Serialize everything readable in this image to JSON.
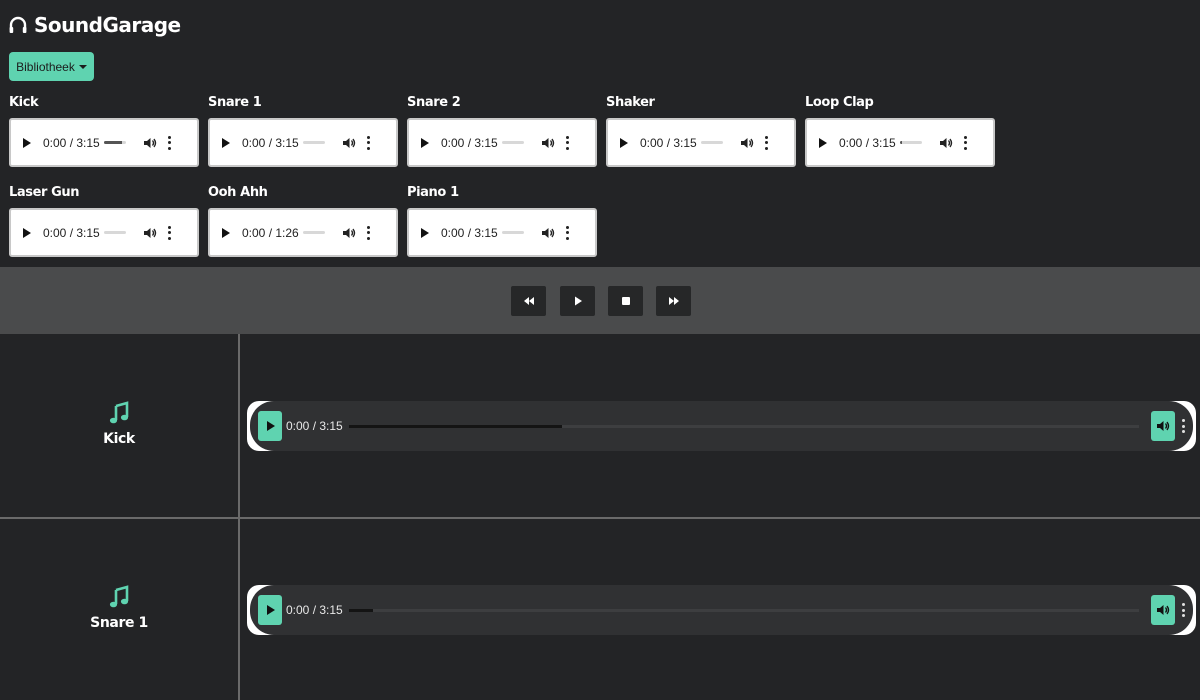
{
  "app": {
    "title": "SoundGarage",
    "library_button": "Bibliotheek",
    "accent_color": "#5fd3b0"
  },
  "library": {
    "clips": [
      {
        "name": "Kick",
        "time": "0:00 / 3:15",
        "progress": 0.8
      },
      {
        "name": "Snare 1",
        "time": "0:00 / 3:15",
        "progress": 0
      },
      {
        "name": "Snare 2",
        "time": "0:00 / 3:15",
        "progress": 0
      },
      {
        "name": "Shaker",
        "time": "0:00 / 3:15",
        "progress": 0
      },
      {
        "name": "Loop Clap",
        "time": "0:00 / 3:15",
        "progress": 0.1
      },
      {
        "name": "Laser Gun",
        "time": "0:00 / 3:15",
        "progress": 0
      },
      {
        "name": "Ooh Ahh",
        "time": "0:00 / 1:26",
        "progress": 0
      },
      {
        "name": "Piano 1",
        "time": "0:00 / 3:15",
        "progress": 0
      }
    ]
  },
  "transport": {
    "buttons": [
      "rewind-icon",
      "play-icon",
      "stop-icon",
      "fast-forward-icon"
    ]
  },
  "tracks": [
    {
      "name": "Kick",
      "time": "0:00 / 3:15",
      "progress": 0.27
    },
    {
      "name": "Snare 1",
      "time": "0:00 / 3:15",
      "progress": 0.03
    }
  ]
}
